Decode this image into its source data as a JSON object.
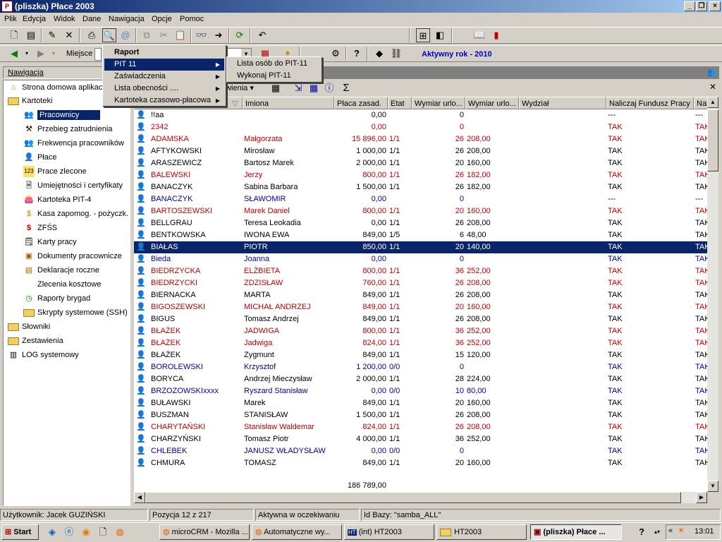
{
  "window": {
    "title": "(pliszka)  Płace 2003",
    "app_icon": "płace-app-icon"
  },
  "menu": [
    "Plik",
    "Edycja",
    "Widok",
    "Dane",
    "Nawigacja",
    "Opcje",
    "Pomoc"
  ],
  "toolbar2": {
    "miejsce_label": "Miejsce",
    "active_year": "Aktywny rok - 2010"
  },
  "popup_menu": {
    "items": [
      {
        "label": "Raport",
        "bold": true,
        "submenu": false
      },
      {
        "label": "PIT 11",
        "bold": false,
        "submenu": true,
        "highlighted": true
      },
      {
        "label": "Zaświadczenia",
        "bold": false,
        "submenu": true
      },
      {
        "label": "Lista obecności ....",
        "bold": false,
        "submenu": true
      },
      {
        "label": "Kartoteka czasowo-płacowa",
        "bold": false,
        "submenu": true
      }
    ]
  },
  "submenu": {
    "items": [
      "Lista osób do PIT-11",
      "Wykonaj PIT-11"
    ]
  },
  "nav": {
    "header": "Nawigacja",
    "top_items": [
      {
        "label": "Strona domowa aplikacji",
        "icon": "home-icon"
      },
      {
        "label": "Kartoteki",
        "icon": "folder-open-icon"
      }
    ],
    "kartoteki_items": [
      {
        "label": "Pracownicy",
        "icon": "employees-icon",
        "selected": true
      },
      {
        "label": "Przebieg zatrudnienia",
        "icon": "employment-history-icon"
      },
      {
        "label": "Frekwencja pracowników",
        "icon": "attendance-icon"
      },
      {
        "label": "Płace",
        "icon": "payroll-icon"
      },
      {
        "label": "Prace zlecone",
        "icon": "contract-work-icon"
      },
      {
        "label": "Umiejętności i certyfikaty",
        "icon": "certificate-icon"
      },
      {
        "label": "Kartoteka PIT-4",
        "icon": "pit4-icon"
      },
      {
        "label": "Kasa zapomog. - pożyczk.",
        "icon": "money-bag-icon"
      },
      {
        "label": "ZFŚS",
        "icon": "zfss-icon"
      },
      {
        "label": "Karty pracy",
        "icon": "work-card-icon"
      },
      {
        "label": "Dokumenty pracownicze",
        "icon": "documents-icon"
      },
      {
        "label": "Deklaracje roczne",
        "icon": "declarations-icon"
      },
      {
        "label": "Zlecenia kosztowe",
        "icon": ""
      },
      {
        "label": "Raporty brygad",
        "icon": "clock-icon"
      },
      {
        "label": "Skrypty systemowe (SSH)",
        "icon": "folder-icon"
      }
    ],
    "bottom_items": [
      {
        "label": "Słowniki",
        "icon": "folder-icon"
      },
      {
        "label": "Zestawienia",
        "icon": "folder-icon"
      },
      {
        "label": "LOG systemowy",
        "icon": "log-icon"
      }
    ]
  },
  "grid_toolbar": {
    "zestawienia_label": "awienia",
    "sum_symbol": "Σ"
  },
  "grid": {
    "columns": [
      "",
      "Imiona",
      "Płaca zasad.",
      "Etat",
      "Wymiar urlo...",
      "Wymiar urlo...",
      "Wydział",
      "Naliczaj Fundusz Pracy",
      "Nal"
    ],
    "rows": [
      {
        "nazwisko": "!!aa",
        "imiona": "",
        "placa": "0,00",
        "etat": "",
        "w1": "0",
        "w2": "",
        "nfp": "---",
        "nal": "---",
        "color": "black"
      },
      {
        "nazwisko": "2342",
        "imiona": "",
        "placa": "0,00",
        "etat": "",
        "w1": "0",
        "w2": "",
        "nfp": "TAK",
        "nal": "TAK",
        "color": "red"
      },
      {
        "nazwisko": "ADAMSKA",
        "imiona": "Małgorzata",
        "placa": "15 896,00",
        "etat": "1/1",
        "w1": "26",
        "w2": "208,00",
        "nfp": "TAK",
        "nal": "TAK",
        "color": "red"
      },
      {
        "nazwisko": "AFTYKOWSKI",
        "imiona": "Mirosław",
        "placa": "1 000,00",
        "etat": "1/1",
        "w1": "26",
        "w2": "208,00",
        "nfp": "TAK",
        "nal": "TAK",
        "color": "black"
      },
      {
        "nazwisko": "ARASZEWICZ",
        "imiona": "Bartosz Marek",
        "placa": "2 000,00",
        "etat": "1/1",
        "w1": "20",
        "w2": "160,00",
        "nfp": "TAK",
        "nal": "TAK",
        "color": "black"
      },
      {
        "nazwisko": "BALEWSKI",
        "imiona": "Jerzy",
        "placa": "800,00",
        "etat": "1/1",
        "w1": "26",
        "w2": "182,00",
        "nfp": "TAK",
        "nal": "TAK",
        "color": "red"
      },
      {
        "nazwisko": "BANACZYK",
        "imiona": "Sabina Barbara",
        "placa": "1 500,00",
        "etat": "1/1",
        "w1": "26",
        "w2": "182,00",
        "nfp": "TAK",
        "nal": "TAK",
        "color": "black"
      },
      {
        "nazwisko": "BANACZYK",
        "imiona": "SŁAWOMIR",
        "placa": "0,00",
        "etat": "",
        "w1": "0",
        "w2": "",
        "nfp": "---",
        "nal": "---",
        "color": "blue"
      },
      {
        "nazwisko": "BARTOSZEWSKI",
        "imiona": "Marek Daniel",
        "placa": "800,00",
        "etat": "1/1",
        "w1": "20",
        "w2": "160,00",
        "nfp": "TAK",
        "nal": "TAK",
        "color": "red"
      },
      {
        "nazwisko": "BELLGRAU",
        "imiona": "Teresa Leokadia",
        "placa": "0,00",
        "etat": "1/1",
        "w1": "26",
        "w2": "208,00",
        "nfp": "TAK",
        "nal": "TAK",
        "color": "black"
      },
      {
        "nazwisko": "BENTKOWSKA",
        "imiona": "IWONA EWA",
        "placa": "849,00",
        "etat": "1/5",
        "w1": "6",
        "w2": "48,00",
        "nfp": "TAK",
        "nal": "TAK",
        "color": "black"
      },
      {
        "nazwisko": "BIAŁAS",
        "imiona": "PIOTR",
        "placa": "850,00",
        "etat": "1/1",
        "w1": "20",
        "w2": "140,00",
        "nfp": "TAK",
        "nal": "TAK",
        "color": "black",
        "selected": true
      },
      {
        "nazwisko": "Bieda",
        "imiona": "Joanna",
        "placa": "0,00",
        "etat": "",
        "w1": "0",
        "w2": "",
        "nfp": "TAK",
        "nal": "TAK",
        "color": "blue"
      },
      {
        "nazwisko": "BIEDRZYCKA",
        "imiona": "ELŻBIETA",
        "placa": "800,00",
        "etat": "1/1",
        "w1": "36",
        "w2": "252,00",
        "nfp": "TAK",
        "nal": "TAK",
        "color": "red"
      },
      {
        "nazwisko": "BIEDRZYCKI",
        "imiona": "ZDZISŁAW",
        "placa": "760,00",
        "etat": "1/1",
        "w1": "26",
        "w2": "208,00",
        "nfp": "TAK",
        "nal": "TAK",
        "color": "red"
      },
      {
        "nazwisko": "BIERNACKA",
        "imiona": "MARTA",
        "placa": "849,00",
        "etat": "1/1",
        "w1": "26",
        "w2": "208,00",
        "nfp": "TAK",
        "nal": "TAK",
        "color": "black"
      },
      {
        "nazwisko": "BIGOSZEWSKI",
        "imiona": "MICHAŁ ANDRZEJ",
        "placa": "849,00",
        "etat": "1/1",
        "w1": "20",
        "w2": "160,00",
        "nfp": "TAK",
        "nal": "TAK",
        "color": "red"
      },
      {
        "nazwisko": "BIGUS",
        "imiona": "Tomasz Andrzej",
        "placa": "849,00",
        "etat": "1/1",
        "w1": "26",
        "w2": "208,00",
        "nfp": "TAK",
        "nal": "TAK",
        "color": "black"
      },
      {
        "nazwisko": "BŁAŻEK",
        "imiona": "JADWIGA",
        "placa": "800,00",
        "etat": "1/1",
        "w1": "36",
        "w2": "252,00",
        "nfp": "TAK",
        "nal": "TAK",
        "color": "red"
      },
      {
        "nazwisko": "BŁAŻEK",
        "imiona": "Jadwiga",
        "placa": "824,00",
        "etat": "1/1",
        "w1": "36",
        "w2": "252,00",
        "nfp": "TAK",
        "nal": "TAK",
        "color": "red"
      },
      {
        "nazwisko": "BŁAŻEK",
        "imiona": "Zygmunt",
        "placa": "849,00",
        "etat": "1/1",
        "w1": "15",
        "w2": "120,00",
        "nfp": "TAK",
        "nal": "TAK",
        "color": "black"
      },
      {
        "nazwisko": "BOROLEWSKI",
        "imiona": "Krzysztof",
        "placa": "1 200,00",
        "etat": "0/0",
        "w1": "0",
        "w2": "",
        "nfp": "TAK",
        "nal": "TAK",
        "color": "blue"
      },
      {
        "nazwisko": "BORYCA",
        "imiona": "Andrzej Mieczysław",
        "placa": "2 000,00",
        "etat": "1/1",
        "w1": "28",
        "w2": "224,00",
        "nfp": "TAK",
        "nal": "TAK",
        "color": "black"
      },
      {
        "nazwisko": "BRZOZOWSKIxxxx",
        "imiona": "Ryszard Stanisław",
        "placa": "0,00",
        "etat": "0/0",
        "w1": "10",
        "w2": "80,00",
        "nfp": "TAK",
        "nal": "TAK",
        "color": "blue"
      },
      {
        "nazwisko": "BUŁAWSKI",
        "imiona": "Marek",
        "placa": "849,00",
        "etat": "1/1",
        "w1": "20",
        "w2": "160,00",
        "nfp": "TAK",
        "nal": "TAK",
        "color": "black"
      },
      {
        "nazwisko": "BUSZMAN",
        "imiona": "STANISŁAW",
        "placa": "1 500,00",
        "etat": "1/1",
        "w1": "26",
        "w2": "208,00",
        "nfp": "TAK",
        "nal": "TAK",
        "color": "black"
      },
      {
        "nazwisko": "CHARYTAŃSKI",
        "imiona": "Stanisław Waldemar",
        "placa": "824,00",
        "etat": "1/1",
        "w1": "26",
        "w2": "208,00",
        "nfp": "TAK",
        "nal": "TAK",
        "color": "red"
      },
      {
        "nazwisko": "CHARZYŃSKI",
        "imiona": "Tomasz Piotr",
        "placa": "4 000,00",
        "etat": "1/1",
        "w1": "36",
        "w2": "252,00",
        "nfp": "TAK",
        "nal": "TAK",
        "color": "black"
      },
      {
        "nazwisko": "CHLEBEK",
        "imiona": "JANUSZ WŁADYSŁAW",
        "placa": "0,00",
        "etat": "0/0",
        "w1": "0",
        "w2": "",
        "nfp": "TAK",
        "nal": "TAK",
        "color": "blue"
      },
      {
        "nazwisko": "CHMURA",
        "imiona": "TOMASZ",
        "placa": "849,00",
        "etat": "1/1",
        "w1": "20",
        "w2": "160,00",
        "nfp": "TAK",
        "nal": "TAK",
        "color": "black"
      }
    ],
    "total": "186 789,00"
  },
  "status": {
    "user": "Użytkownik: Jacek GUZIŃSKI",
    "position": "Pozycja 12 z 217",
    "state": "Aktywna w oczekiwaniu",
    "db": "Id Bazy: \"samba_ALL\""
  },
  "taskbar": {
    "start": "Start",
    "tasks": [
      {
        "label": "microCRM - Mozilla ...",
        "icon": "firefox-icon"
      },
      {
        "label": "Automatyczne wy...",
        "icon": "firefox-icon"
      },
      {
        "label": "(int)  HT2003",
        "icon": "ht-icon"
      },
      {
        "label": "HT2003",
        "icon": "folder-icon"
      },
      {
        "label": "(pliszka)  Płace ...",
        "icon": "płace-app-icon",
        "active": true
      }
    ],
    "clock": "13:01"
  },
  "colors": {
    "red": "#c00000",
    "blue": "#0000a0",
    "black": "#000000",
    "selection": "#0a246a"
  }
}
